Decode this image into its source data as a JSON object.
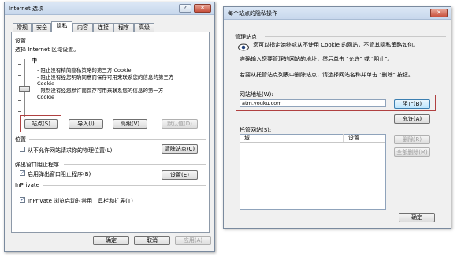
{
  "left": {
    "title": "Internet 选项",
    "tabs": [
      "常规",
      "安全",
      "隐私",
      "内容",
      "连接",
      "程序",
      "高级"
    ],
    "settings_heading": "设置",
    "zone_label": "选择 Internet 区域设置。",
    "level": "中",
    "bullets": [
      "- 阻止没有精简隐私策略的第三方 Cookie",
      "- 阻止没有经您明确同意而保存可用来联系您的信息的第三方 Cookie",
      "- 限制没有经您默许而保存可用来联系您的信息的第一方 Cookie"
    ],
    "buttons": {
      "sites": "站点(S)",
      "import": "导入(I)",
      "advanced": "高级(V)",
      "default": "默认值(D)"
    },
    "location_heading": "位置",
    "location_checkbox": "从不允许网站请求你的物理位置(L)",
    "clear_sites": "清除站点(C)",
    "popup_heading": "弹出窗口阻止程序",
    "popup_checkbox": "启用弹出窗口阻止程序(B)",
    "popup_settings": "设置(E)",
    "inprivate_heading": "InPrivate",
    "inprivate_checkbox": "InPrivate 浏览启动时禁用工具栏和扩展(T)",
    "footer": {
      "ok": "确定",
      "cancel": "取消",
      "apply": "应用(A)"
    }
  },
  "right": {
    "title": "每个站点的隐私操作",
    "manage_heading": "管理站点",
    "desc1": "您可以指定始终或从不使用 Cookie 的网站，不管其隐私策略如何。",
    "desc2": "准确输入您要管理的网站的地址，然后单击 \"允许\" 或 \"阻止\"。",
    "desc3": "若要从托管站点列表中删除站点，请选择网站名称并单击 \"删除\" 按钮。",
    "address_label": "网站地址(W):",
    "address_value": "atm.youku.com",
    "block": "阻止(B)",
    "allow": "允许(A)",
    "managed_label": "托管网站(S):",
    "col_domain": "域",
    "col_setting": "设置",
    "remove": "删除(R)",
    "remove_all": "全部删除(M)",
    "ok": "确定"
  }
}
